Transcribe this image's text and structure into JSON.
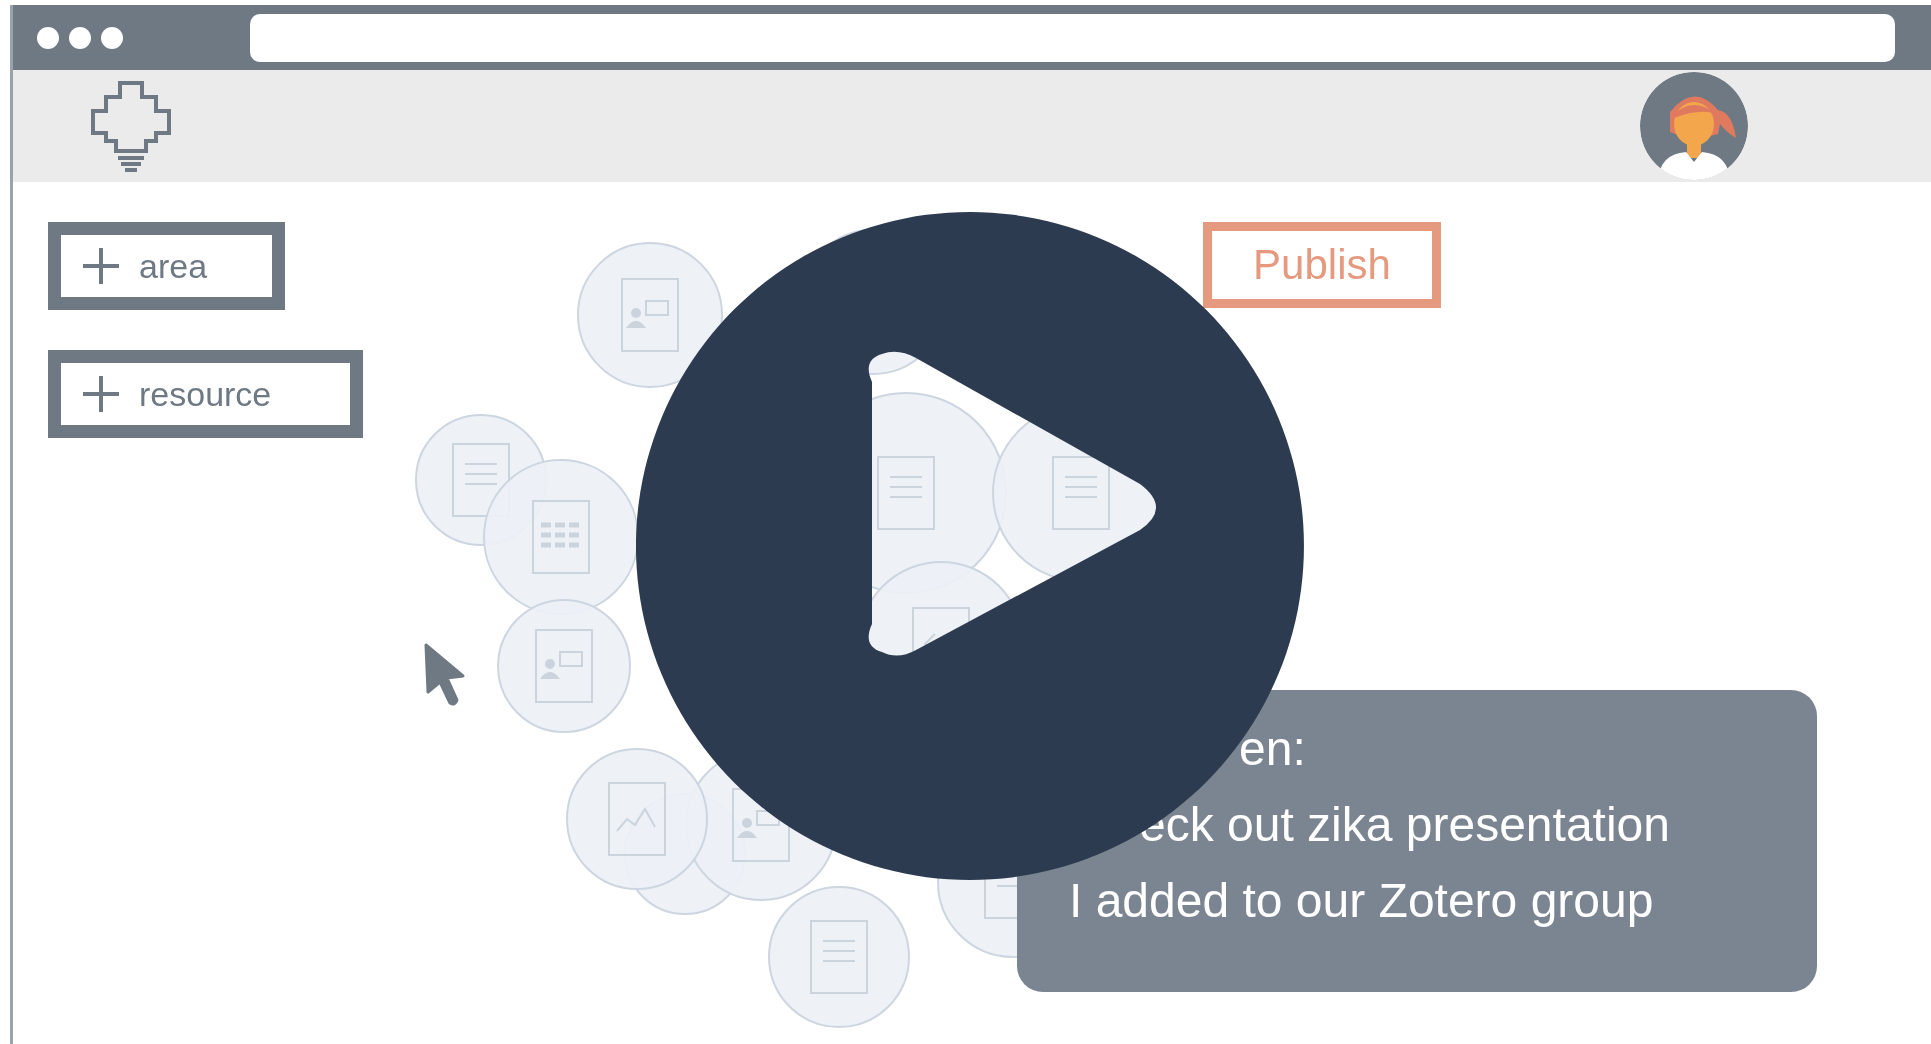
{
  "buttons": [
    {
      "label": "area"
    },
    {
      "label": "resource"
    }
  ],
  "publish_button": {
    "label": "Publish"
  },
  "tooltip": {
    "lines": [
      "en:",
      "eck out zika presentation",
      "I added to our Zotero group"
    ]
  }
}
